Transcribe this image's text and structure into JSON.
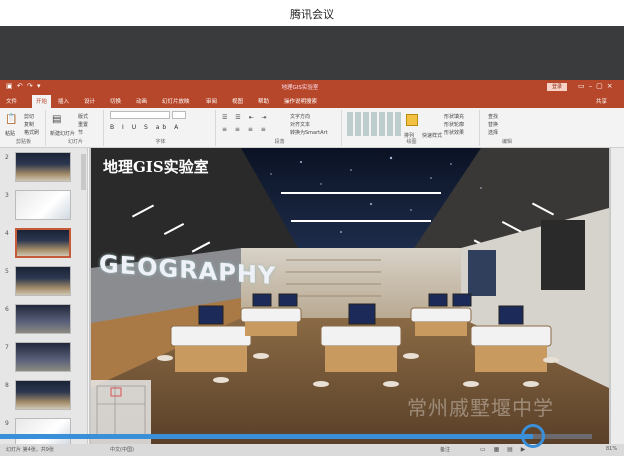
{
  "meeting": {
    "title": "腾讯会议"
  },
  "powerpoint": {
    "title": "地理GIS实验室",
    "login": "登录",
    "share": "共享",
    "tabs": [
      {
        "label": "文件",
        "active": false
      },
      {
        "label": "开始",
        "active": true
      },
      {
        "label": "插入",
        "active": false
      },
      {
        "label": "设计",
        "active": false
      },
      {
        "label": "切换",
        "active": false
      },
      {
        "label": "动画",
        "active": false
      },
      {
        "label": "幻灯片放映",
        "active": false
      },
      {
        "label": "审阅",
        "active": false
      },
      {
        "label": "视图",
        "active": false
      },
      {
        "label": "帮助",
        "active": false
      },
      {
        "label": "操作说明搜索",
        "active": false
      }
    ],
    "ribbon": {
      "clipboard": {
        "label": "剪贴板",
        "paste": "粘贴",
        "cut": "剪切",
        "copy": "复制",
        "painter": "格式刷"
      },
      "slides": {
        "label": "幻灯片",
        "new_slide": "新建幻灯片",
        "layout": "版式",
        "reset": "重置",
        "section": "节"
      },
      "font": {
        "label": "字体"
      },
      "paragraph": {
        "label": "段落",
        "text_direction": "文字方向",
        "align_text": "对齐文本",
        "smartart": "转换为SmartArt"
      },
      "drawing": {
        "label": "绘图",
        "arrange": "排列",
        "quick_styles": "快速样式",
        "fill": "形状填充",
        "outline": "形状轮廓",
        "effects": "形状效果"
      },
      "editing": {
        "label": "编辑",
        "find": "查找",
        "replace": "替换",
        "select": "选择"
      }
    },
    "thumbnails": [
      {
        "num": "2",
        "style": "room",
        "selected": false
      },
      {
        "num": "3",
        "style": "plan",
        "selected": false
      },
      {
        "num": "4",
        "style": "room",
        "selected": true
      },
      {
        "num": "5",
        "style": "room",
        "selected": false
      },
      {
        "num": "6",
        "style": "dark",
        "selected": false
      },
      {
        "num": "7",
        "style": "dark",
        "selected": false
      },
      {
        "num": "8",
        "style": "room",
        "selected": false
      },
      {
        "num": "9",
        "style": "plan",
        "selected": false
      }
    ],
    "slide": {
      "title": "地理GIS实验室",
      "sign": "GEOGRAPHY",
      "watermark": "常州戚墅堰中学"
    },
    "status": {
      "slide_info": "幻灯片 第4张，共9张",
      "language": "中文(中国)",
      "notes": "备注",
      "zoom": "81%"
    }
  },
  "progress": {
    "fraction": 0.9
  },
  "colors": {
    "accent": "#b7472a",
    "progress": "#3a8fd9"
  }
}
